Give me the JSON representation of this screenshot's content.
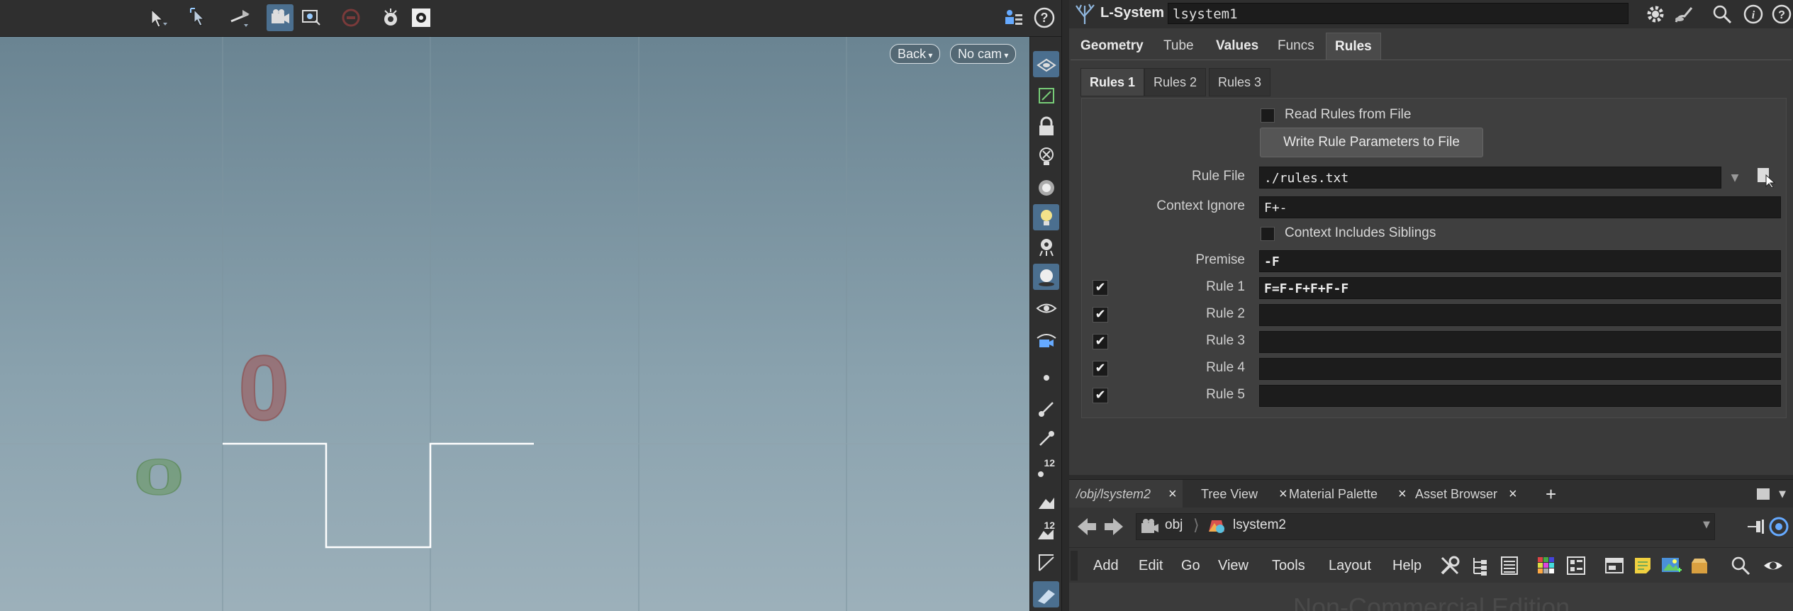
{
  "viewport": {
    "back_label": "Back",
    "camera_label": "No cam",
    "origin_label_x": "0",
    "origin_label_z": "0",
    "side_badge_1": "12",
    "side_badge_2": "12"
  },
  "colors": {
    "accent": "#4b6f8f",
    "field_bg": "#1c1c1c",
    "panel_bg": "#3a3a3a"
  },
  "node": {
    "type_label": "L-System",
    "name": "lsystem1"
  },
  "tabs": [
    "Geometry",
    "Tube",
    "Values",
    "Funcs",
    "Rules"
  ],
  "active_tab": "Rules",
  "subtabs": [
    "Rules 1",
    "Rules 2",
    "Rules 3"
  ],
  "active_subtab": "Rules 1",
  "rules": {
    "read_rules_label": "Read Rules from File",
    "read_rules_checked": false,
    "write_button_label": "Write Rule Parameters to File",
    "rule_file_label": "Rule File",
    "rule_file_value": "./rules.txt",
    "context_ignore_label": "Context Ignore",
    "context_ignore_value": "F+-",
    "context_siblings_label": "Context Includes Siblings",
    "context_siblings_checked": false,
    "premise_label": "Premise",
    "premise_value": "-F",
    "rule_rows": [
      {
        "label": "Rule 1",
        "value": "F=F-F+F+F-F",
        "enabled": true
      },
      {
        "label": "Rule 2",
        "value": "",
        "enabled": true
      },
      {
        "label": "Rule 3",
        "value": "",
        "enabled": true
      },
      {
        "label": "Rule 4",
        "value": "",
        "enabled": true
      },
      {
        "label": "Rule 5",
        "value": "",
        "enabled": true
      }
    ]
  },
  "network": {
    "tabs": [
      "/obj/lsystem2",
      "Tree View",
      "Material Palette",
      "Asset Browser"
    ],
    "path_root": "obj",
    "path_node": "lsystem2",
    "menu": [
      "Add",
      "Edit",
      "Go",
      "View",
      "Tools",
      "Layout",
      "Help"
    ],
    "watermark": "Non-Commercial Edition"
  }
}
